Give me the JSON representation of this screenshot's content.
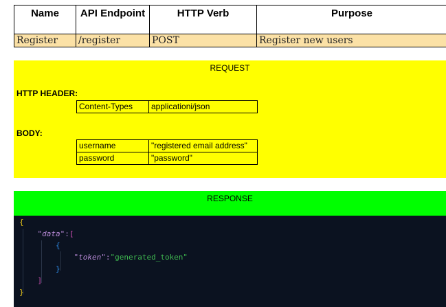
{
  "api_table": {
    "headers": [
      "Name",
      "API Endpoint",
      "HTTP Verb",
      "Purpose"
    ],
    "row": [
      "Register",
      "/register",
      "POST",
      "Register new users"
    ]
  },
  "request": {
    "title": "REQUEST",
    "header_label": "HTTP HEADER:",
    "headers": [
      {
        "key": "Content-Types",
        "value": "applicationi/json"
      }
    ],
    "body_label": "BODY:",
    "body": [
      {
        "key": "username",
        "value": "\"registered email address\""
      },
      {
        "key": "password",
        "value": "\"password\""
      }
    ]
  },
  "response": {
    "title": "RESPONSE",
    "code": {
      "open_brace": "{",
      "data_key": "\"data\"",
      "colon": ":",
      "open_bracket": "[",
      "inner_open": "{",
      "token_key": "\"token\"",
      "token_value": "\"generated_token\"",
      "inner_close": "}",
      "close_bracket": "]",
      "close_brace": "}"
    }
  },
  "colors": {
    "request_bg": "#ffff00",
    "response_bg": "#00ff00",
    "row_bg": "#fbe1a6",
    "code_bg": "#0b1220"
  }
}
